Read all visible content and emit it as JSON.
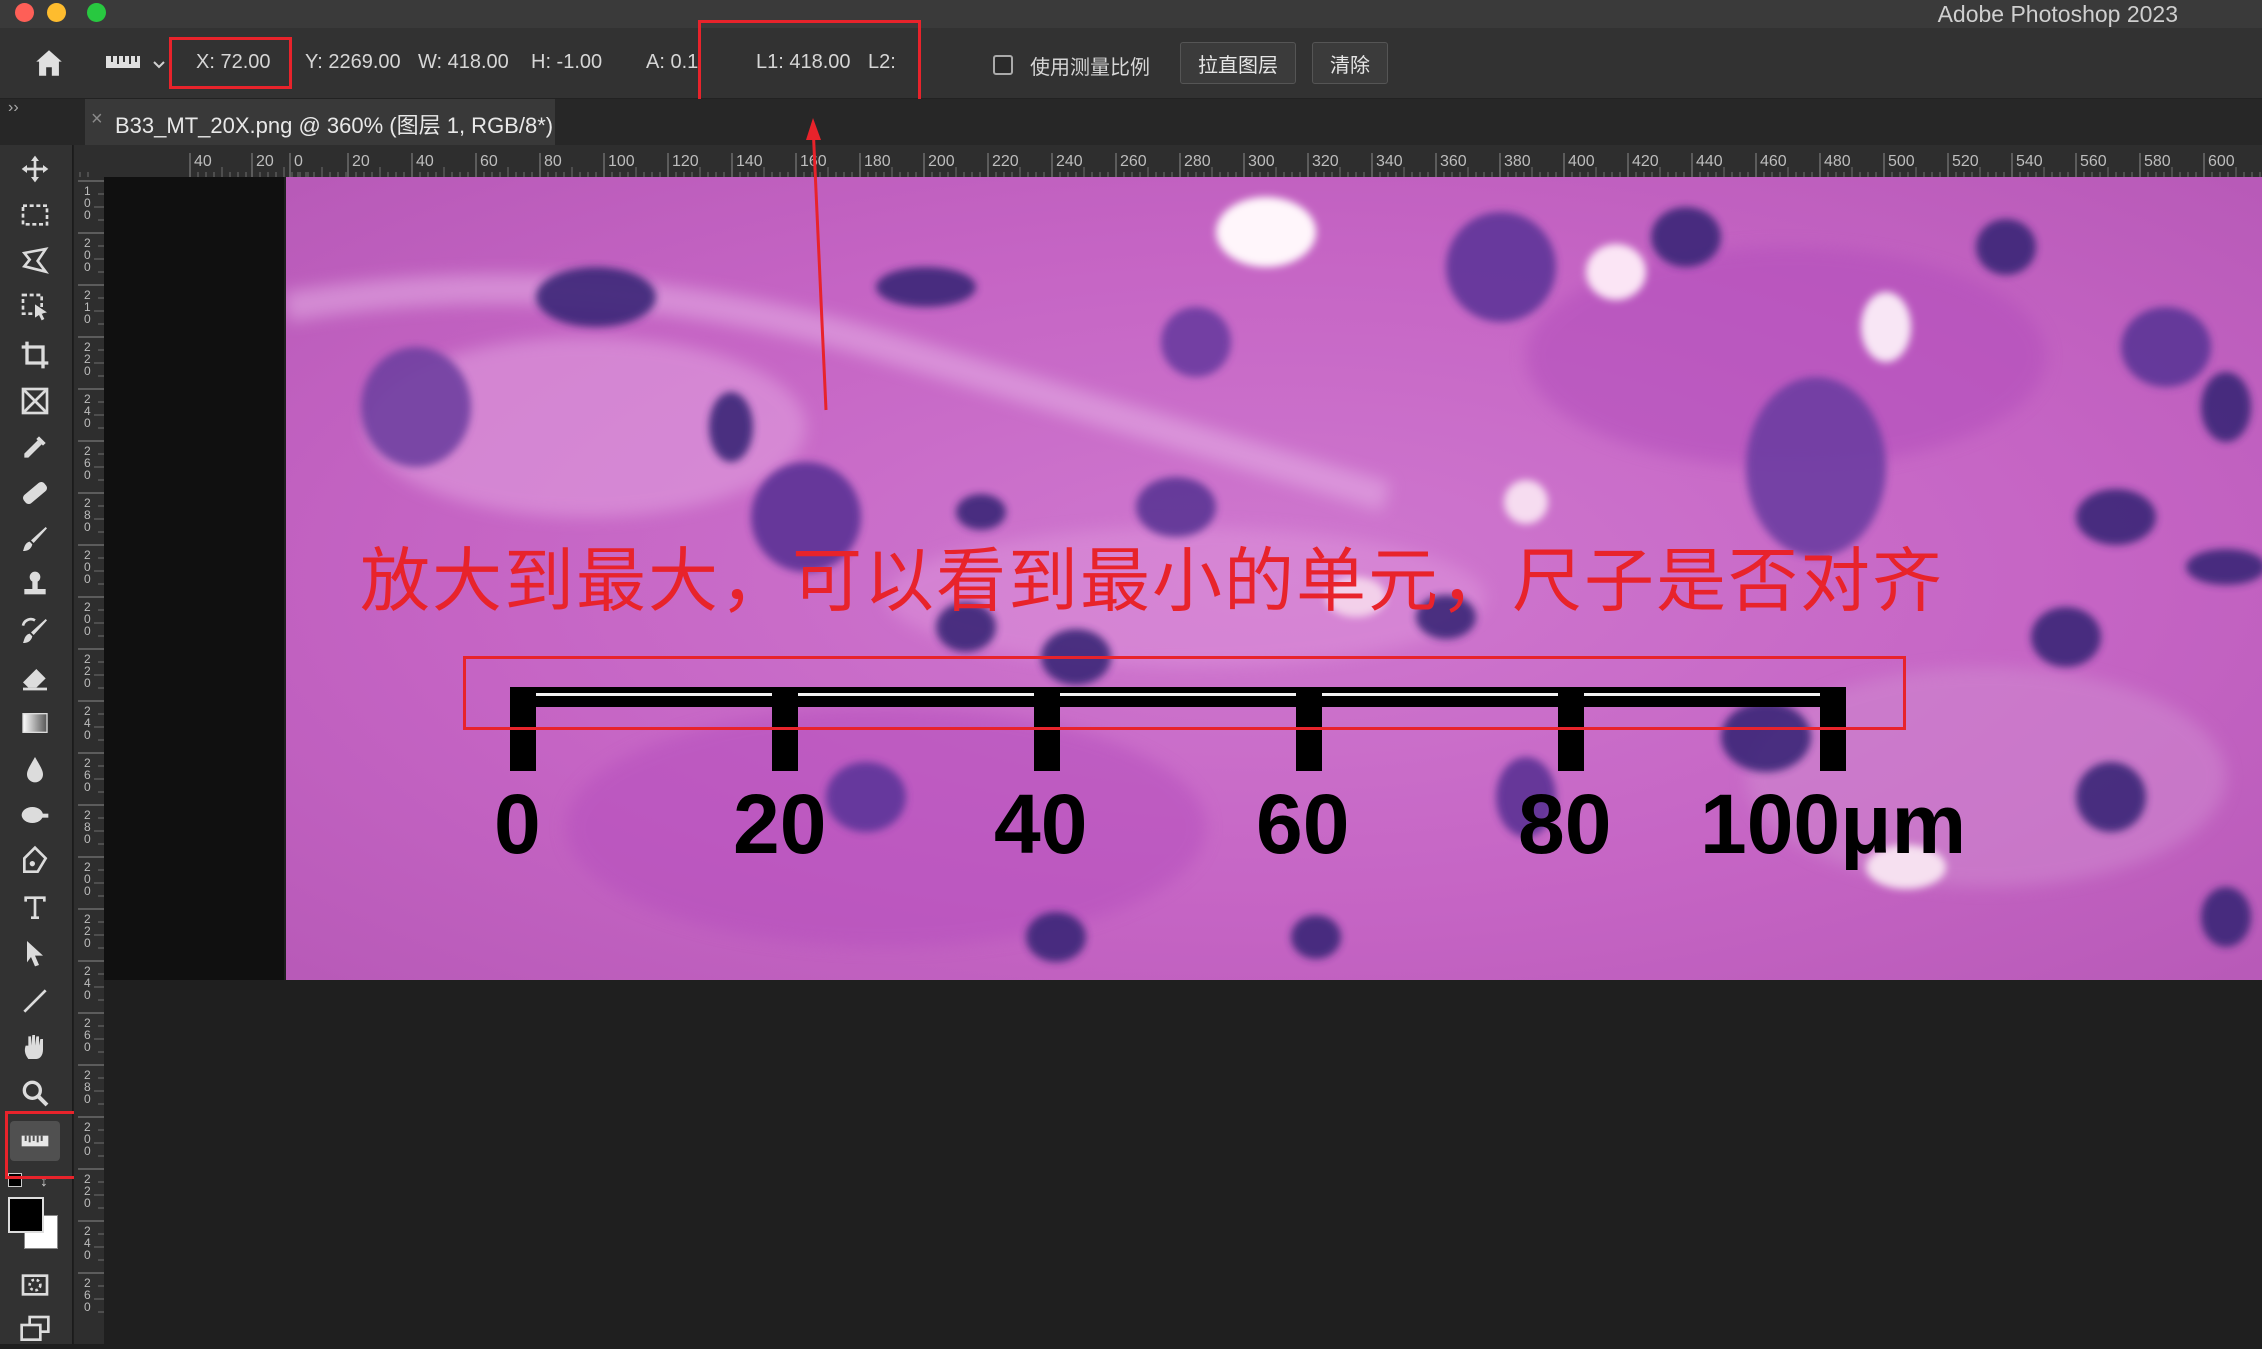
{
  "app": {
    "title": "Adobe Photoshop 2023"
  },
  "options_bar": {
    "x": "X: 72.00",
    "y": "Y: 2269.00",
    "w": "W: 418.00",
    "h": "H: -1.00",
    "a": "A: 0.1°",
    "l1": "L1: 418.00",
    "l2": "L2:",
    "use_scale_label": "使用测量比例",
    "straighten_label": "拉直图层",
    "clear_label": "清除"
  },
  "document": {
    "tab_title": "B33_MT_20X.png @ 360% (图层 1, RGB/8*)"
  },
  "ruler": {
    "h_ticks": [
      "0",
      "40",
      "20",
      "0",
      "20",
      "40",
      "60",
      "80",
      "100",
      "120",
      "140",
      "160",
      "180",
      "200",
      "220",
      "240",
      "260",
      "280",
      "300",
      "320",
      "340",
      "360",
      "380",
      "400",
      "420",
      "440",
      "460",
      "480",
      "500",
      "520",
      "540",
      "560",
      "580",
      "600"
    ],
    "v_ticks": [
      "1\n0\n0",
      "2\n0\n0",
      "2\n1\n0",
      "2\n2\n0",
      "2\n4\n0",
      "2\n6\n0",
      "2\n8\n0",
      "2\n0\n0",
      "2\n0\n0",
      "2\n2\n0",
      "2\n4\n0",
      "2\n6\n0",
      "2\n8\n0",
      "2\n0\n0",
      "2\n2\n0",
      "2\n4\n0",
      "2\n6\n0",
      "2\n8\n0",
      "2\n0\n0",
      "2\n2\n0",
      "2\n4\n0",
      "2\n6\n0"
    ]
  },
  "image_content": {
    "annotation": "放大到最大，可以看到最小的单元，尺子是否对齐",
    "scale_labels": [
      "0",
      "20",
      "40",
      "60",
      "80",
      "100μm"
    ]
  },
  "tools": [
    "move-icon",
    "marquee-icon",
    "lasso-icon",
    "object-select-icon",
    "crop-icon",
    "frame-icon",
    "eyedropper-icon",
    "healing-icon",
    "brush-icon",
    "stamp-icon",
    "history-brush-icon",
    "eraser-icon",
    "gradient-icon",
    "blur-icon",
    "dodge-icon",
    "pen-icon",
    "type-icon",
    "path-select-icon",
    "line-icon",
    "hand-icon",
    "zoom-icon",
    "ruler-icon"
  ],
  "colors": {
    "annotation_red": "#e8232b",
    "tissue_pink": "#c86ac6",
    "nucleus": "#3a2a7a"
  }
}
